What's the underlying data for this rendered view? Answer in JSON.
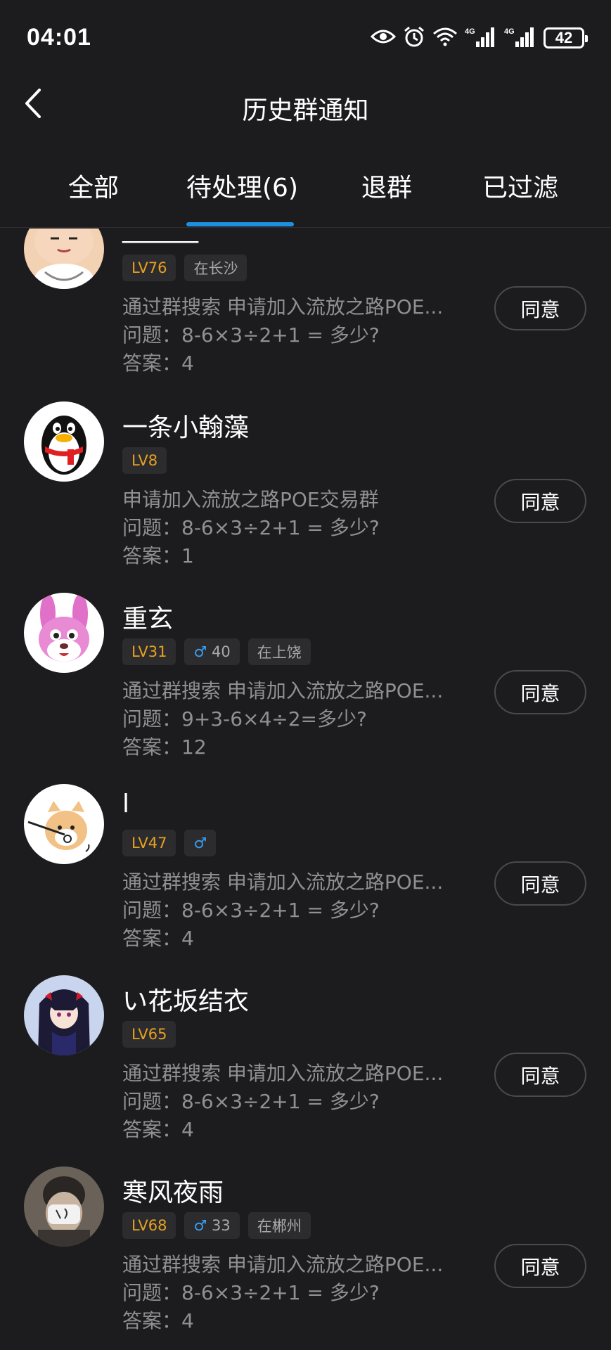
{
  "status_bar": {
    "time": "04:01",
    "battery": "42",
    "network_labels": [
      "4G",
      "4G"
    ]
  },
  "header": {
    "title": "历史群通知"
  },
  "tabs": [
    {
      "label": "全部",
      "active": false
    },
    {
      "label": "待处理(6)",
      "active": true
    },
    {
      "label": "退群",
      "active": false
    },
    {
      "label": "已过滤",
      "active": false
    }
  ],
  "colors": {
    "background": "#1c1c1e",
    "accent": "#1e8fe1",
    "level_badge": "#e8a020",
    "male_badge": "#3a9ef0"
  },
  "requests": [
    {
      "name": "______",
      "level": "LV76",
      "gender": "",
      "age": "",
      "location": "在长沙",
      "message": "通过群搜索 申请加入流放之路POE...",
      "question": "问题：8-6×3÷2+1 = 多少?",
      "answer": "答案：4",
      "action": "同意"
    },
    {
      "name": "一条小翰藻",
      "level": "LV8",
      "gender": "",
      "age": "",
      "location": "",
      "message": "申请加入流放之路POE交易群",
      "question": "问题：8-6×3÷2+1 = 多少?",
      "answer": "答案：1",
      "action": "同意"
    },
    {
      "name": "重玄",
      "level": "LV31",
      "gender": "♂",
      "age": "40",
      "location": "在上饶",
      "message": "通过群搜索 申请加入流放之路POE...",
      "question": "问题：9+3-6×4÷2=多少?",
      "answer": "答案：12",
      "action": "同意"
    },
    {
      "name": "l",
      "level": "LV47",
      "gender": "♂",
      "age": "",
      "location": "",
      "message": "通过群搜索 申请加入流放之路POE...",
      "question": "问题：8-6×3÷2+1 = 多少?",
      "answer": "答案：4",
      "action": "同意"
    },
    {
      "name": "い花坂结衣",
      "level": "LV65",
      "gender": "",
      "age": "",
      "location": "",
      "message": "通过群搜索 申请加入流放之路POE...",
      "question": "问题：8-6×3÷2+1 = 多少?",
      "answer": "答案：4",
      "action": "同意"
    },
    {
      "name": "寒风夜雨",
      "level": "LV68",
      "gender": "♂",
      "age": "33",
      "location": "在郴州",
      "message": "通过群搜索 申请加入流放之路POE...",
      "question": "问题：8-6×3÷2+1 = 多少?",
      "answer": "答案：4",
      "action": "同意"
    }
  ]
}
